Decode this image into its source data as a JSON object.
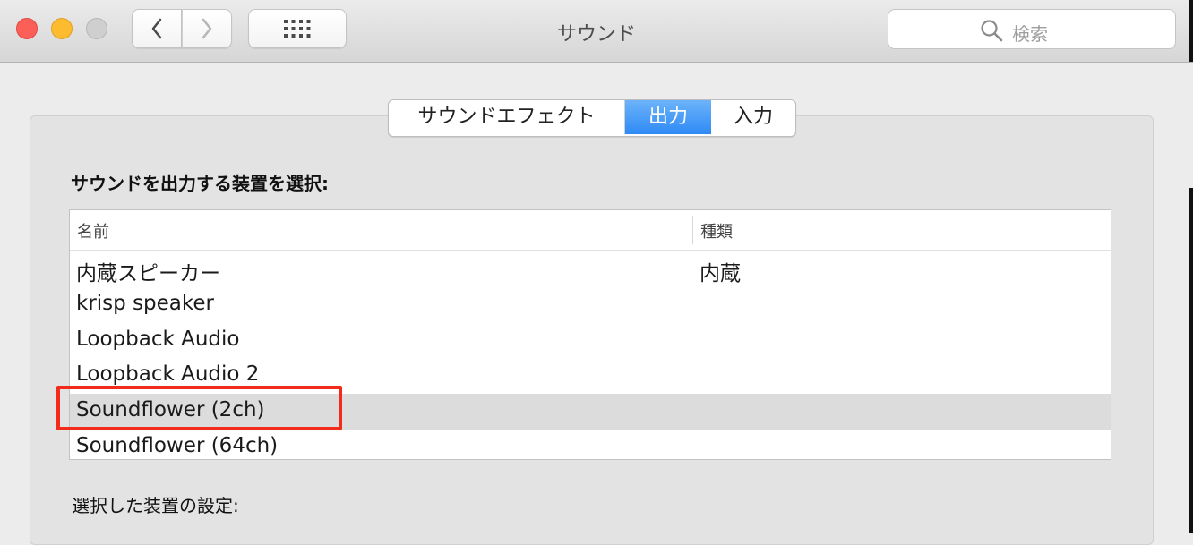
{
  "window": {
    "title": "サウンド",
    "buttons": {
      "close": "close-button",
      "minimize": "minimize-button",
      "zoom": "zoom-button"
    },
    "nav": {
      "back_icon": "chevron-left-icon",
      "forward_icon": "chevron-right-icon",
      "show_all_icon": "grid-icon"
    },
    "search": {
      "placeholder": "検索",
      "icon": "search-icon"
    }
  },
  "tabs": [
    {
      "label": "サウンドエフェクト",
      "selected": false
    },
    {
      "label": "出力",
      "selected": true
    },
    {
      "label": "入力",
      "selected": false
    }
  ],
  "output": {
    "heading": "サウンドを出力する装置を選択:",
    "columns": {
      "name": "名前",
      "kind": "種類"
    },
    "devices": [
      {
        "name": "内蔵スピーカー",
        "kind": "内蔵"
      },
      {
        "name": "krisp speaker",
        "kind": ""
      },
      {
        "name": "Loopback Audio",
        "kind": ""
      },
      {
        "name": "Loopback Audio 2",
        "kind": ""
      },
      {
        "name": "Soundflower (2ch)",
        "kind": ""
      },
      {
        "name": "Soundflower (64ch)",
        "kind": ""
      }
    ],
    "selected_device": "Soundflower (2ch)",
    "settings_heading": "選択した装置の設定:"
  },
  "colors": {
    "accent": "#2f8af5",
    "annotation": "#f22b1b",
    "selected_row": "#dcdcdc"
  }
}
